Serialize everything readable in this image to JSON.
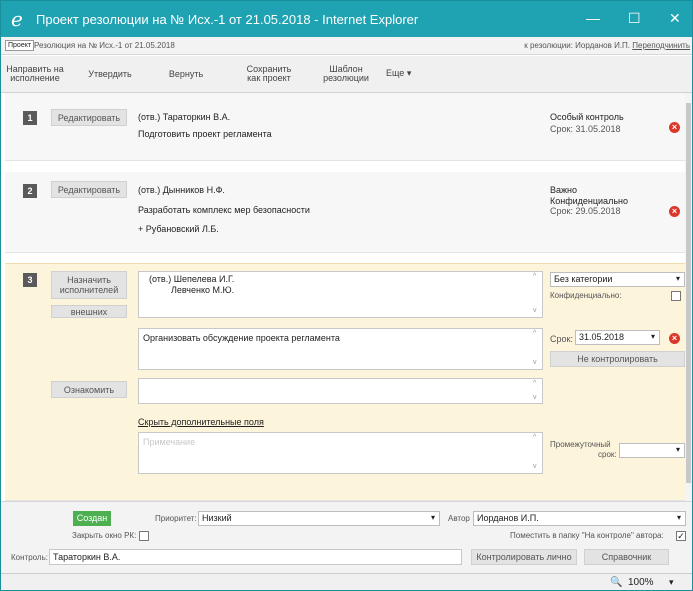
{
  "window": {
    "title": "Проект резолюции на № Исх.-1 от 21.05.2018 - Internet Explorer",
    "ie_icon": "e",
    "minimize": "—",
    "maximize": "☐",
    "close": "✕"
  },
  "addressbar": {
    "tag": "Проект",
    "crumb": "Резолюция на № Исх.-1 от 21.05.2018",
    "right_text": "к резолюции: Иорданов И.П.",
    "right_link": "Переподчинить"
  },
  "toolbar": {
    "send": "Направить на исполнение",
    "approve": "Утвердить",
    "return": "Вернуть",
    "save_project": "Сохранить как проект",
    "template": "Шаблон резолюции",
    "more": "Еще ▾"
  },
  "items": [
    {
      "number": "1",
      "edit_label": "Редактировать",
      "responsible": "(отв.) Тараторкин В.А.",
      "task": "Подготовить проект регламента",
      "control": "Особый контроль",
      "deadline": "Срок: 31.05.2018"
    },
    {
      "number": "2",
      "edit_label": "Редактировать",
      "responsible": "(отв.) Дынников Н.Ф.",
      "task": "Разработать комплекс мер безопасности",
      "coexecutor": "+ Рубановский Л.Б.",
      "importance": "Важно",
      "privacy": "Конфиденциально",
      "deadline": "Срок: 29.05.2018"
    }
  ],
  "editor": {
    "number": "3",
    "assign_label": "Назначить исполнителей",
    "external_label": "внешних",
    "executor_1": "(отв.) Шепелева И.Г.",
    "executor_2": "Левченко М.Ю.",
    "category": "Без категории",
    "confidential_label": "Конфиденциально:",
    "task_text": "Организовать обсуждение проекта регламента",
    "deadline_label": "Срок:",
    "deadline_value": "31.05.2018",
    "no_control_label": "Не контролировать",
    "acquaint_label": "Ознакомить",
    "hide_fields_label": "Скрыть дополнительные поля",
    "note_placeholder": "Примечание",
    "interim_label_1": "Промежуточный",
    "interim_label_2": "срок:"
  },
  "footer": {
    "status_badge": "Создан",
    "priority_label": "Приоритет:",
    "priority_value": "Низкий",
    "author_label": "Автор",
    "author_value": "Иорданов И.П.",
    "close_rk_label": "Закрыть окно РК:",
    "put_control_label": "Поместить в папку \"На контроле\" автора:",
    "control_label": "Контроль:",
    "control_value": "Тараторкин В.А.",
    "control_personally": "Контролировать лично",
    "reference": "Справочник"
  },
  "statusbar": {
    "zoom": "100%"
  },
  "colors": {
    "titlebar": "#1fa3b3",
    "editor_bg": "#fdf4dc",
    "delete_red": "#d9382b",
    "status_green": "#4caf50"
  }
}
